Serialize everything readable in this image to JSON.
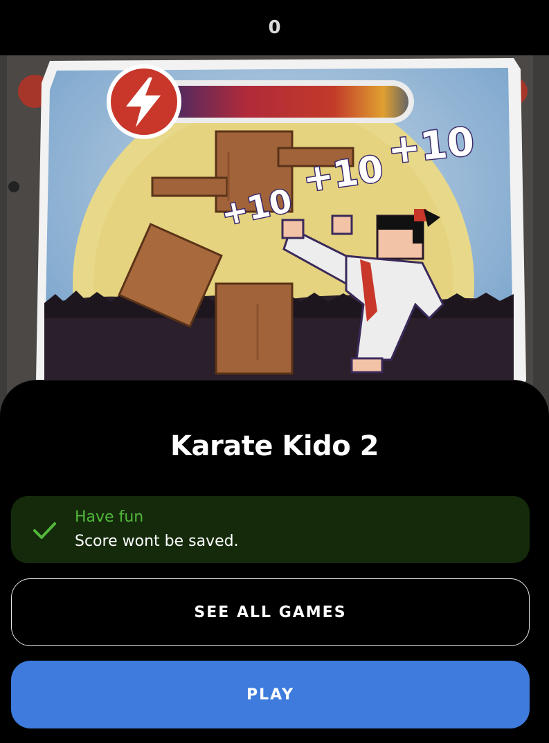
{
  "header": {
    "score": "0"
  },
  "game": {
    "floating_scores": [
      "+10",
      "+10",
      "+10"
    ]
  },
  "sheet": {
    "title": "Karate Kido 2",
    "notice": {
      "icon": "check-icon",
      "title": "Have fun",
      "text": "Score wont be saved."
    },
    "see_all_label": "SEE ALL GAMES",
    "play_label": "PLAY"
  },
  "colors": {
    "play_button": "#3e7bdc",
    "notice_bg": "#142a0b",
    "notice_title": "#52b83a",
    "energy_icon": "#c8372a"
  }
}
